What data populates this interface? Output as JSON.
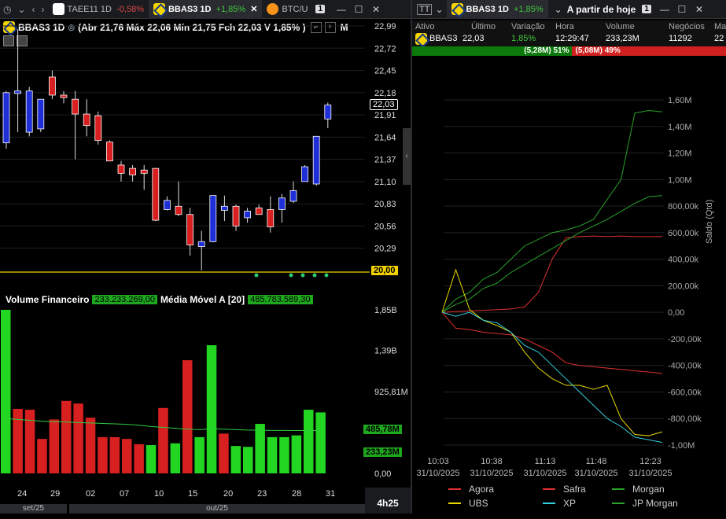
{
  "tabs": [
    {
      "logo": "taee-logo",
      "name": "TAEE11 1D",
      "change": "-0,58%",
      "change_color": "#e04848"
    },
    {
      "logo": "bb-logo",
      "name": "BBAS3 1D",
      "change": "+1,85%",
      "change_color": "#3ec83e"
    },
    {
      "logo": "btc-logo",
      "name": "BTC/U"
    }
  ],
  "tab_count": "1",
  "chart_header": {
    "symbol": "BBAS3 1D",
    "ohlc": "(Abr 21,76 Máx 22,06 Mín 21,75 Fch 22,03 V 1,85% )",
    "more": "M"
  },
  "right_panel": {
    "symbol": "BBAS3 1D",
    "change": "+1,85%",
    "period": "A partir de hoje",
    "count": "1",
    "columns": [
      "Ativo",
      "Último",
      "Variação",
      "Hora",
      "Volume",
      "Negócios",
      "Ma"
    ],
    "row": [
      "BBAS3",
      "22,03",
      "1,85%",
      "12:29:47",
      "233,23M",
      "11292",
      "22"
    ],
    "buy_bar": "(5,28M) 51%",
    "sell_bar": "(5,08M) 49%",
    "buy_fraction": 0.51
  },
  "chart_data": [
    {
      "type": "candlestick",
      "yticks": [
        "22,99",
        "22,72",
        "22,45",
        "22,18",
        "21,91",
        "21,64",
        "21,37",
        "21,10",
        "20,83",
        "20,56",
        "20,29"
      ],
      "ylim": [
        20.0,
        23.0
      ],
      "last_price_tag": "22,03",
      "level_tag": "20,00",
      "xticks": [
        "24",
        "29",
        "02",
        "07",
        "10",
        "15",
        "20",
        "23",
        "28",
        "31"
      ],
      "month_labels": [
        "set/25",
        "out/25"
      ],
      "timeframe": "4h25",
      "candles": [
        {
          "o": 21.57,
          "h": 22.2,
          "l": 21.5,
          "c": 22.18
        },
        {
          "o": 22.17,
          "h": 22.95,
          "l": 21.7,
          "c": 22.2
        },
        {
          "o": 21.7,
          "h": 22.25,
          "l": 21.65,
          "c": 22.2
        },
        {
          "o": 21.74,
          "h": 22.1,
          "l": 21.7,
          "c": 22.1
        },
        {
          "o": 22.37,
          "h": 22.45,
          "l": 22.1,
          "c": 22.15
        },
        {
          "o": 22.15,
          "h": 22.2,
          "l": 22.05,
          "c": 22.12
        },
        {
          "o": 22.1,
          "h": 22.2,
          "l": 21.37,
          "c": 21.92
        },
        {
          "o": 21.92,
          "h": 22.1,
          "l": 21.65,
          "c": 21.78
        },
        {
          "o": 21.9,
          "h": 21.95,
          "l": 21.55,
          "c": 21.6
        },
        {
          "o": 21.58,
          "h": 21.6,
          "l": 21.35,
          "c": 21.35
        },
        {
          "o": 21.3,
          "h": 21.35,
          "l": 21.1,
          "c": 21.2
        },
        {
          "o": 21.26,
          "h": 21.3,
          "l": 21.1,
          "c": 21.18
        },
        {
          "o": 21.24,
          "h": 21.3,
          "l": 21.0,
          "c": 21.2
        },
        {
          "o": 21.26,
          "h": 21.26,
          "l": 20.62,
          "c": 20.63
        },
        {
          "o": 20.76,
          "h": 20.92,
          "l": 20.75,
          "c": 20.87
        },
        {
          "o": 20.8,
          "h": 21.1,
          "l": 20.68,
          "c": 20.7
        },
        {
          "o": 20.7,
          "h": 20.78,
          "l": 20.2,
          "c": 20.33
        },
        {
          "o": 20.31,
          "h": 20.5,
          "l": 20.02,
          "c": 20.37
        },
        {
          "o": 20.37,
          "h": 20.92,
          "l": 20.36,
          "c": 20.93
        },
        {
          "o": 20.75,
          "h": 20.93,
          "l": 20.62,
          "c": 20.8
        },
        {
          "o": 20.8,
          "h": 20.82,
          "l": 20.5,
          "c": 20.56
        },
        {
          "o": 20.66,
          "h": 20.78,
          "l": 20.6,
          "c": 20.74
        },
        {
          "o": 20.78,
          "h": 20.82,
          "l": 20.7,
          "c": 20.7
        },
        {
          "o": 20.76,
          "h": 20.92,
          "l": 20.48,
          "c": 20.55
        },
        {
          "o": 20.76,
          "h": 20.95,
          "l": 20.6,
          "c": 20.9
        },
        {
          "o": 20.86,
          "h": 21.1,
          "l": 20.84,
          "c": 20.99
        },
        {
          "o": 21.1,
          "h": 21.3,
          "l": 21.1,
          "c": 21.28
        },
        {
          "o": 21.07,
          "h": 21.65,
          "l": 21.05,
          "c": 21.65
        },
        {
          "o": 21.86,
          "h": 22.06,
          "l": 21.75,
          "c": 22.03
        }
      ],
      "signal_dots": 5
    },
    {
      "type": "bar",
      "title": "Volume Financeiro",
      "value_badge": "233.233.269,00",
      "ma_label": "Média Móvel A [20]",
      "ma_badge": "485.783.589,30",
      "yticks": [
        "1,85B",
        "1,39B",
        "925,81M",
        "0,00"
      ],
      "tags": [
        "485,78M",
        "233,23M"
      ],
      "ylim": [
        0,
        1850000000
      ],
      "values": [
        1850,
        730,
        720,
        390,
        610,
        820,
        790,
        630,
        410,
        410,
        390,
        330,
        320,
        740,
        340,
        1280,
        410,
        1450,
        450,
        310,
        300,
        560,
        410,
        410,
        430,
        720,
        690
      ],
      "colors": [
        "g",
        "r",
        "r",
        "r",
        "r",
        "r",
        "r",
        "r",
        "r",
        "r",
        "r",
        "r",
        "g",
        "r",
        "g",
        "r",
        "g",
        "g",
        "r",
        "g",
        "g",
        "g",
        "g",
        "g",
        "g",
        "g",
        "g"
      ],
      "ma": [
        620,
        610,
        600,
        590,
        585,
        580,
        575,
        570,
        565,
        560,
        555,
        545,
        530,
        520,
        510,
        500,
        495,
        505,
        500,
        495,
        490,
        488,
        486,
        486,
        485,
        485,
        485
      ]
    },
    {
      "type": "line",
      "ylabel": "Saldo (Qtd)",
      "yticks": [
        "1,60M",
        "1,40M",
        "1,20M",
        "1,00M",
        "800,00k",
        "600,00k",
        "400,00k",
        "200,00k",
        "0,00",
        "-200,00k",
        "-400,00k",
        "-600,00k",
        "-800,00k",
        "-1,00M"
      ],
      "ylim": [
        -1000000,
        1600000
      ],
      "xticks": [
        [
          "10:03",
          "31/10/2025"
        ],
        [
          "10:38",
          "31/10/2025"
        ],
        [
          "11:13",
          "31/10/2025"
        ],
        [
          "11:48",
          "31/10/2025"
        ],
        [
          "12:23",
          "31/10/2025"
        ]
      ],
      "series": [
        {
          "name": "Agora",
          "color": "#e03030",
          "y": [
            0,
            -120,
            -130,
            -150,
            -160,
            -170,
            -200,
            -250,
            -300,
            -380,
            -400,
            -410,
            -420,
            -430,
            -440,
            -450,
            -460
          ]
        },
        {
          "name": "Safra",
          "color": "#e03030",
          "y": [
            0,
            5,
            10,
            15,
            20,
            25,
            40,
            150,
            400,
            560,
            570,
            575,
            570,
            575,
            570,
            570,
            570
          ]
        },
        {
          "name": "Morgan",
          "color": "#2aa12a",
          "y": [
            0,
            100,
            150,
            250,
            300,
            400,
            500,
            550,
            600,
            620,
            650,
            700,
            850,
            1000,
            1500,
            1520,
            1510
          ]
        },
        {
          "name": "UBS",
          "color": "#e8d800",
          "y": [
            0,
            320,
            20,
            -60,
            -100,
            -150,
            -300,
            -420,
            -500,
            -550,
            -550,
            -580,
            -550,
            -800,
            -920,
            -930,
            -900
          ]
        },
        {
          "name": "XP",
          "color": "#30d0e0",
          "y": [
            0,
            -30,
            0,
            -60,
            -80,
            -150,
            -250,
            -300,
            -400,
            -500,
            -600,
            -700,
            -800,
            -860,
            -940,
            -960,
            -980
          ]
        },
        {
          "name": "JP Morgan",
          "color": "#2aa12a",
          "y": [
            0,
            60,
            100,
            180,
            220,
            300,
            360,
            420,
            480,
            540,
            600,
            650,
            700,
            760,
            820,
            870,
            880
          ]
        }
      ]
    }
  ]
}
